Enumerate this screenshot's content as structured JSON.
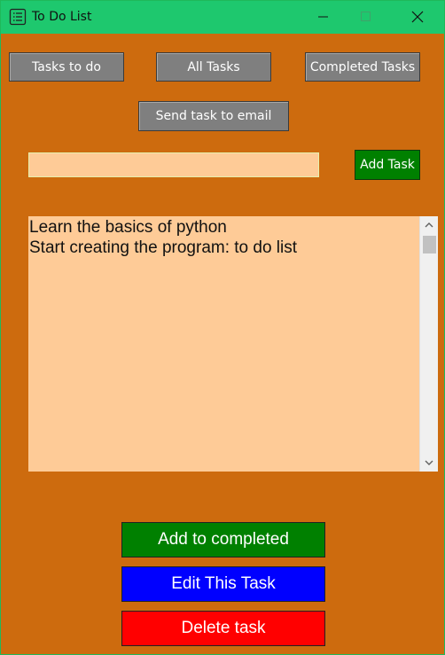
{
  "window": {
    "title": "To Do List",
    "icon": "list-icon",
    "controls": [
      "minimize-icon",
      "maximize-icon",
      "close-icon"
    ]
  },
  "nav": {
    "tasks_todo": "Tasks to do",
    "all_tasks": "All Tasks",
    "completed_tasks": "Completed Tasks",
    "send_email": "Send task to email"
  },
  "input": {
    "value": "",
    "add_label": "Add Task"
  },
  "tasks": [
    "Learn the basics of python",
    "Start creating the program: to do list"
  ],
  "actions": {
    "add_completed": "Add to completed",
    "edit": "Edit This Task",
    "delete": "Delete task"
  },
  "colors": {
    "titlebar": "#1ec86e",
    "background": "#cd6b0e",
    "nav_button": "#7f7f7f",
    "field": "#fecb97",
    "add_task": "#008000",
    "add_completed": "#008000",
    "edit": "#0000ff",
    "delete": "#ff0000"
  }
}
